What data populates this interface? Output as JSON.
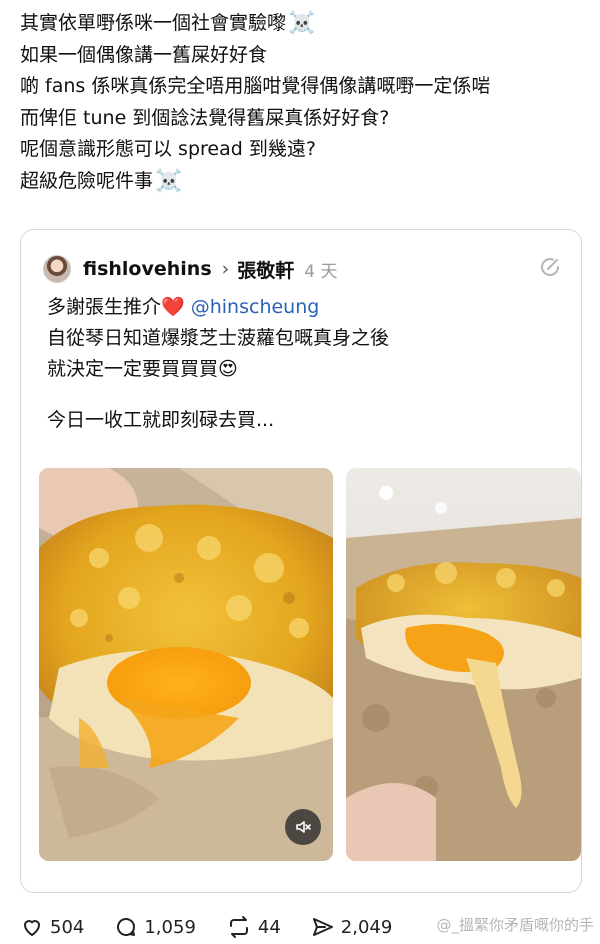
{
  "post": {
    "lines": [
      "其實依單嘢係咪一個社會實驗嚟",
      "如果一個偶像講一舊屎好好食",
      "啲 fans 係咪真係完全唔用腦咁覺得偶像講嘅嘢一定係啱",
      "而俾佢 tune 到個諗法覺得舊屎真係好好食?",
      "呢個意識形態可以 spread 到幾遠?",
      "超級危險呢件事"
    ],
    "skull_emoji": "☠️"
  },
  "quote": {
    "username": "fishlovehins",
    "chevron": "›",
    "ref_name": "張敬軒",
    "time": "4 天",
    "line1_text": "多謝張生推介",
    "heart_emoji": "❤️",
    "mention": "@hinscheung",
    "line2": "自從琴日知道爆漿芝士菠蘿包嘅真身之後",
    "line3_text": "就決定一定要買買買",
    "heart_eyes_emoji": "😍",
    "line4": "今日一收工就即刻碌去買..."
  },
  "actions": {
    "likes": "504",
    "replies": "1,059",
    "reposts": "44",
    "shares": "2,049"
  },
  "watermark": "@_搵緊你矛盾嘅你的手",
  "icons": {
    "like": "heart-outline-icon",
    "reply": "speech-bubble-icon",
    "repost": "repost-arrows-icon",
    "share": "send-icon",
    "edit": "edit-icon",
    "mute": "muted-speaker-icon"
  },
  "colors": {
    "mention": "#2a62b8",
    "time": "#9a9a9a",
    "border": "#d7d7d7"
  }
}
